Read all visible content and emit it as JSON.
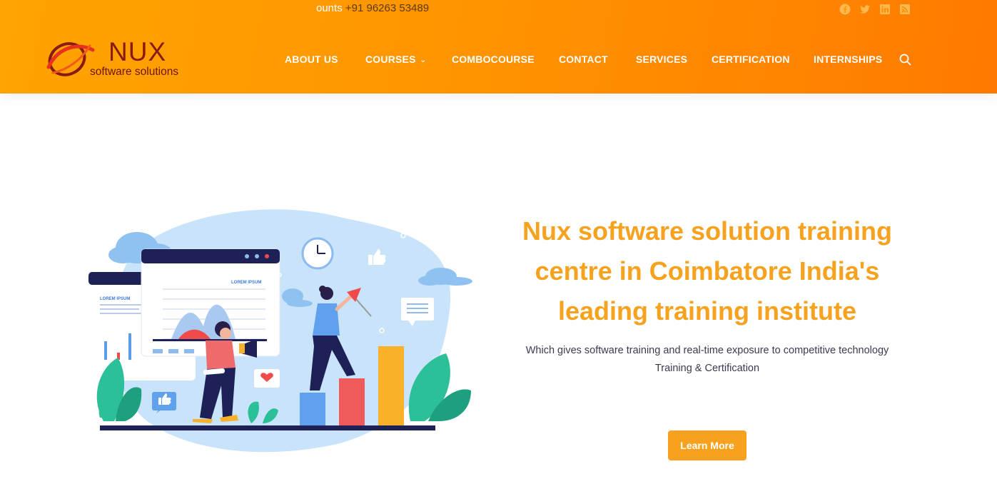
{
  "topbar": {
    "text_prefix": "ounts",
    "phone": "+91 96263 53489",
    "social_icons": [
      "facebook-icon",
      "twitter-icon",
      "linkedin-icon",
      "rss-icon"
    ]
  },
  "logo": {
    "brand": "NUX",
    "tagline": "software solutions"
  },
  "nav": {
    "items": [
      {
        "label": "ABOUT US"
      },
      {
        "label": "COURSES",
        "chevron": "⌄"
      },
      {
        "label": "COMBOCOURSE"
      },
      {
        "label": "CONTACT"
      },
      {
        "label": "SERVICES"
      },
      {
        "label": "CERTIFICATION"
      },
      {
        "label": "INTERNSHIPS"
      }
    ],
    "search_icon": "search-icon"
  },
  "hero": {
    "title_line1": "Nux software solution training",
    "title_line2": "centre in Coimbatore India's",
    "title_line3": "leading training institute",
    "desc_line1": "Which gives software training and real-time exposure to competitive technology",
    "desc_line2": "Training & Certification",
    "cta_label": "Learn More"
  },
  "illustration": {
    "chart_label_1": "LOREM IPSUM",
    "chart_label_2": "LOREM IPSUM"
  },
  "colors": {
    "header_start": "#ffa400",
    "header_end": "#ff7a00",
    "accent": "#f6a21e",
    "text_dark": "#3a3a52"
  }
}
